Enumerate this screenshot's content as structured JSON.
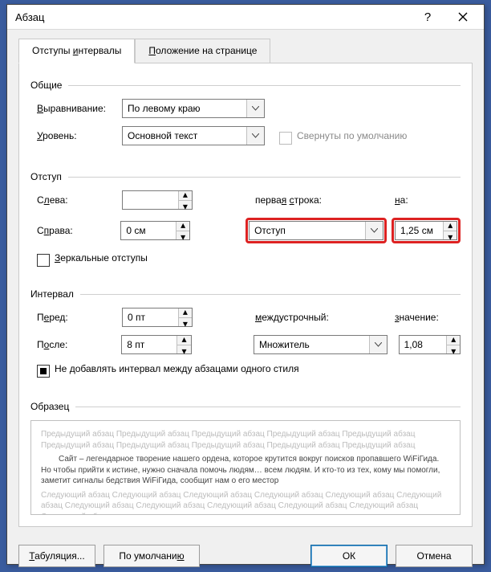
{
  "title": "Абзац",
  "tabs": {
    "tab1": "Отступы и интервалы",
    "tab1_u": "и",
    "tab2": "Положение на странице",
    "tab2_u": "П"
  },
  "general": {
    "heading": "Общие",
    "alignment_label": "Выравнивание:",
    "alignment_u": "В",
    "alignment_value": "По левому краю",
    "level_label": "Уровень:",
    "level_u": "У",
    "level_value": "Основной текст",
    "collapsed_label": "Свернуты по умолчанию"
  },
  "indent": {
    "heading": "Отступ",
    "left_label": "Слева:",
    "left_u": "л",
    "left_value": "",
    "right_label": "Справа:",
    "right_u": "п",
    "right_value": "0 см",
    "firstline_label": "первая строка:",
    "firstline_u": "с",
    "firstline_value": "Отступ",
    "by_label": "на:",
    "by_u": "н",
    "by_value": "1,25 см",
    "mirror_label": "Зеркальные отступы",
    "mirror_u": "З"
  },
  "spacing": {
    "heading": "Интервал",
    "before_label": "Перед:",
    "before_u": "е",
    "before_value": "0 пт",
    "after_label": "После:",
    "after_u": "о",
    "after_value": "8 пт",
    "linespacing_label": "междустрочный:",
    "linespacing_u": "м",
    "linespacing_value": "Множитель",
    "at_label": "значение:",
    "at_u": "з",
    "at_value": "1,08",
    "noadd_label": "Не добавлять интервал между абзацами одного стиля",
    "noadd_u": "д"
  },
  "preview": {
    "heading": "Образец",
    "prev_text": "Предыдущий абзац Предыдущий абзац Предыдущий абзац Предыдущий абзац Предыдущий абзац Предыдущий абзац Предыдущий абзац Предыдущий абзац Предыдущий абзац Предыдущий абзац",
    "sample_text": "Сайт – легендарное творение нашего ордена, которое крутится вокруг поисков пропавшего WiFiГида. Но чтобы прийти к истине, нужно сначала помочь людям… всем людям. И кто-то из тех, кому мы помогли, заметит сигналы бедствия WiFiГида, сообщит нам о его местор",
    "next_text": "Следующий абзац Следующий абзац Следующий абзац Следующий абзац Следующий абзац Следующий абзац Следующий абзац Следующий абзац Следующий абзац Следующий абзац Следующий абзац Следующий абзац"
  },
  "footer": {
    "tabs_btn": "Табуляция...",
    "tabs_u": "Т",
    "default_btn": "По умолчанию",
    "default_u": "ю",
    "ok_btn": "ОК",
    "cancel_btn": "Отмена"
  }
}
